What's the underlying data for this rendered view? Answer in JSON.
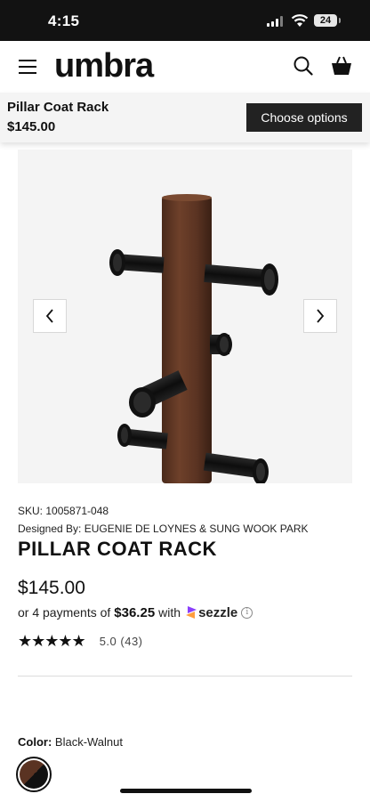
{
  "status_bar": {
    "time": "4:15",
    "battery": "24"
  },
  "header": {
    "logo": "umbra"
  },
  "sticky": {
    "name": "Pillar Coat Rack",
    "price": "$145.00",
    "cta": "Choose options"
  },
  "product": {
    "sku": "SKU: 1005871-048",
    "designer": "Designed By: EUGENIE DE LOYNES & SUNG WOOK PARK",
    "title": "PILLAR COAT RACK",
    "price": "$145.00",
    "installments_prefix": "or 4 payments of",
    "installment_amount": "$36.25",
    "installments_with": "with",
    "payment_provider": "sezzle",
    "stars": "★★★★★",
    "rating": "5.0",
    "review_count": "(43)",
    "color_label": "Color:",
    "color_value": "Black-Walnut"
  },
  "colors": {
    "wood": "#5a3322",
    "hook": "#151515",
    "accent": "#222222"
  }
}
